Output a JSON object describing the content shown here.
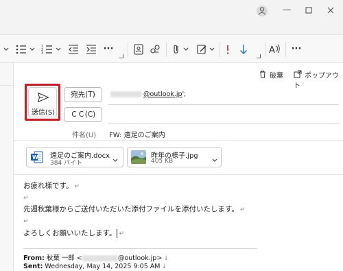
{
  "colors": {
    "highlight": "#e0141e",
    "word_blue": "#185abd",
    "accent_blue": "#1d6fd8",
    "important_red": "#d13438"
  },
  "ribbon": {
    "icons": [
      "chevron-down-icon",
      "bullet-list-icon",
      "numbered-list-icon",
      "decrease-indent-icon",
      "increase-indent-icon",
      "more-icon",
      "address-book-icon",
      "check-names-icon",
      "attach-file-icon",
      "signature-icon",
      "high-importance-icon",
      "low-importance-icon",
      "dictate-icon",
      "more-options-icon"
    ],
    "more1": "···",
    "more2": "···"
  },
  "actions": {
    "discard": "破棄",
    "popout": "ポップアウト"
  },
  "send": {
    "label": "送信(S)"
  },
  "to": {
    "button": "宛先(T)",
    "email_visible": "@outlook.jp",
    "suffix": "';"
  },
  "cc": {
    "button": "ＣＣ(C)"
  },
  "subject": {
    "label": "件名(U)",
    "value": "FW: 遠足のご案内"
  },
  "attachments": [
    {
      "name": "遠足のご案内.docx",
      "size": "384 バイト",
      "icon": "word-icon"
    },
    {
      "name": "昨年の様子.jpg",
      "size": "405 KB",
      "icon": "image-thumbnail"
    }
  ],
  "body": {
    "line1": "お疲れ様です。",
    "line2": "先週秋葉様からご送付いただいた添付ファイルを添付いたします。",
    "line3": "よろしくお願いいたします。",
    "return_mark": "↵"
  },
  "forward_header": {
    "from_label": "From:",
    "from_value_prefix": " 秋葉 一郎 <",
    "from_value_suffix": "@outlook.jp>",
    "from_mark": "↓",
    "sent_label": "Sent:",
    "sent_value": " Wednesday, May 14, 2025 9:05 AM",
    "sent_mark": "↓"
  }
}
